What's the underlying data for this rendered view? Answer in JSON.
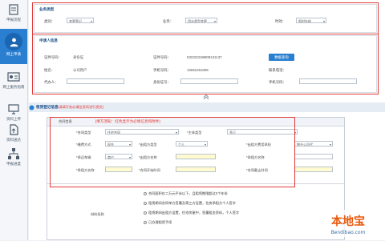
{
  "sidebar": {
    "items": [
      {
        "label": "申报流程",
        "icon": "document-icon"
      },
      {
        "label": "网上申请",
        "icon": "user-form-icon",
        "active": true
      },
      {
        "label": "网上服务指南",
        "icon": "id-card-icon"
      },
      {
        "label": "资料上传",
        "icon": "monitor-icon"
      },
      {
        "label": "资料送达",
        "icon": "file-upload-icon"
      },
      {
        "label": "申报进度",
        "icon": "network-icon"
      }
    ]
  },
  "section1": {
    "title": "业务类型",
    "fields": [
      {
        "label": "类别：",
        "value": "变更登记"
      },
      {
        "label": "业务：",
        "value": "用水类型变更"
      },
      {
        "label": "时效：",
        "value": "即时办结"
      }
    ]
  },
  "section2": {
    "title": "申请人信息",
    "fields": [
      {
        "label": "证件号码：",
        "value": "身份证"
      },
      {
        "label": "证件号码：",
        "value": "532323198808131137"
      },
      {
        "label": "姓名：",
        "value": "公司用户"
      },
      {
        "label": "手机号码：",
        "value": "15652453395"
      },
      {
        "label": "联系电话：",
        "value": ""
      },
      {
        "label": "代办人：",
        "value": ""
      },
      {
        "label": "身份证号：",
        "value": ""
      },
      {
        "label": "手机号码：",
        "value": ""
      }
    ],
    "button": "数据查询"
  },
  "section3": {
    "title": "租赁登记信息",
    "title_note": "(请填写各必填信息再进行提交)",
    "header_label": "合同信息",
    "header_hint": "[填写须知：红色显示为必填信息和附件]",
    "rows": [
      {
        "label": "*合同类型",
        "value": "住宅合同",
        "label2": "*主体类型",
        "value2": "签订"
      },
      {
        "label": "*缴费方式",
        "value": "现金",
        "label2": "*出租方类型",
        "value2": "个人",
        "label3": "*出租方费用承担",
        "value3": "物业公司代"
      },
      {
        "label": "*承运车辆",
        "value": "商户",
        "label2": "*出租方名称",
        "value2": "",
        "label3": "*承租方名称",
        "value3": ""
      },
      {
        "label": "*承租方名称",
        "value": "",
        "label2": "*合同开始时间",
        "value2": "",
        "label3": "*合同截止时间",
        "value3": ""
      }
    ],
    "material_label": "材料条款",
    "options": [
      "合同面积在二万元平米以下，且租赁期限超过2个年份",
      "租赁期间合同单方签署及第三方设置，住房承租方个人签字",
      "租赁期间出租方设置，住宅房屋中，签署租金资料，个人签字",
      "已办理租赁手续"
    ]
  },
  "watermark": {
    "brand": "本地宝",
    "url": "Bendibao.com"
  },
  "colors": {
    "accent": "#2a7fd0",
    "highlight": "#e23a3a",
    "sidebar_bg": "#f4f6f9"
  }
}
